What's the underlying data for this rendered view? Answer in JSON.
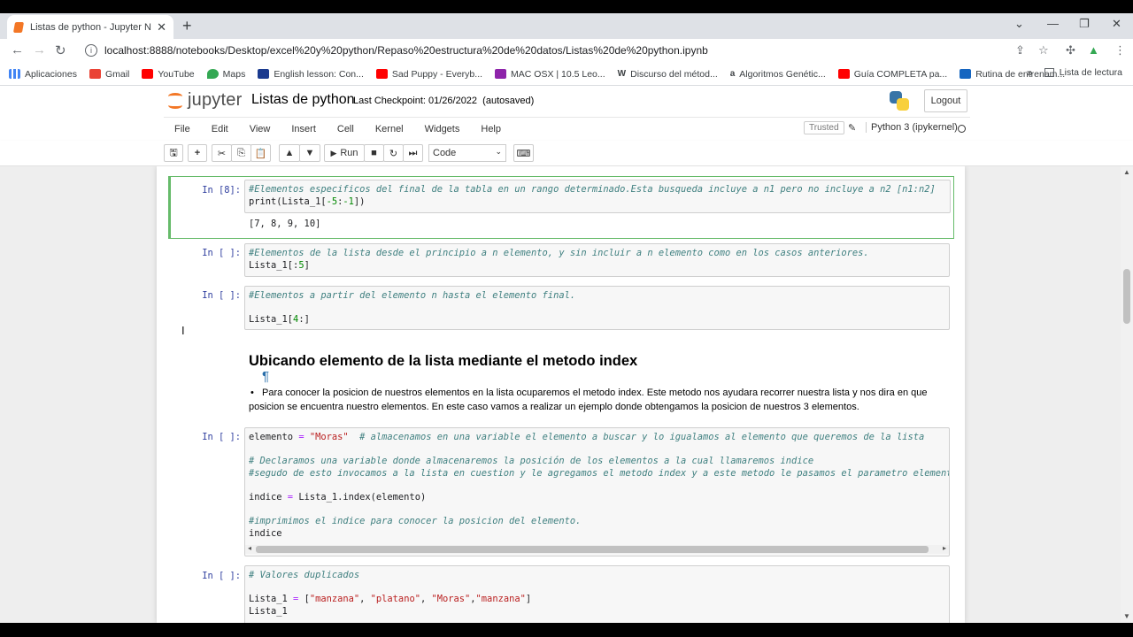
{
  "browser": {
    "tab_title": "Listas de python - Jupyter Noteb",
    "url": "localhost:8888/notebooks/Desktop/excel%20y%20python/Repaso%20estructura%20de%20datos/Listas%20de%20python.ipynb",
    "bookmarks": [
      {
        "label": "Aplicaciones",
        "color": "#4285f4"
      },
      {
        "label": "Gmail",
        "color": "#ea4335"
      },
      {
        "label": "YouTube",
        "color": "#ff0000"
      },
      {
        "label": "Maps",
        "color": "#34a853"
      },
      {
        "label": "English lesson: Con...",
        "color": "#1a3a8f"
      },
      {
        "label": "Sad Puppy - Everyb...",
        "color": "#ff0000"
      },
      {
        "label": "MAC OSX | 10.5 Leo...",
        "color": "#8e24aa"
      },
      {
        "label": "Discurso del métod...",
        "color": "#000000"
      },
      {
        "label": "Algoritmos Genétic...",
        "color": "#ff9900"
      },
      {
        "label": "Guía COMPLETA pa...",
        "color": "#ff0000"
      },
      {
        "label": "Rutina de entrenam...",
        "color": "#1565c0"
      }
    ],
    "more_bookmarks": "»",
    "reading_list": "Lista de lectura"
  },
  "jupyter": {
    "logo_text": "jupyter",
    "notebook_name": "Listas de python",
    "checkpoint": "Last Checkpoint: 01/26/2022",
    "autosaved": "(autosaved)",
    "logout": "Logout",
    "menus": [
      "File",
      "Edit",
      "View",
      "Insert",
      "Cell",
      "Kernel",
      "Widgets",
      "Help"
    ],
    "trusted": "Trusted",
    "kernel_name": "Python 3 (ipykernel)",
    "run_label": "Run",
    "cell_type": "Code"
  },
  "cells": {
    "c1": {
      "prompt": "In [8]:",
      "line1": "#Elementos especificos del final de la tabla en un rango determinado.Esta busqueda incluye a n1 pero no incluye a n2 [n1:n2]",
      "line2_a": "print(Lista_1[",
      "line2_b": "-5",
      "line2_c": ":",
      "line2_d": "-1",
      "line2_e": "])",
      "output": "[7, 8, 9, 10]"
    },
    "c2": {
      "prompt": "In [ ]:",
      "line1": "#Elementos de la lista desde el principio a n elemento, y sin incluir a n elemento como en los casos anteriores.",
      "line2_a": "Lista_1[:",
      "line2_b": "5",
      "line2_c": "]"
    },
    "c3": {
      "prompt": "In [ ]:",
      "line1": "#Elementos a partir del elemento n hasta el elemento final.",
      "line2_a": "Lista_1[",
      "line2_b": "4",
      "line2_c": ":]"
    },
    "md": {
      "heading": "Ubicando elemento de la lista mediante el metodo index",
      "pilcrow": "¶",
      "bullet": "Para conocer la posicion de nuestros elementos en la lista ocuparemos el metodo index. Este metodo nos ayudara recorrer nuestra lista y nos dira en que posicion se encuentra nuestro elementos. En este caso vamos a realizar un ejemplo donde obtengamos la posicion de nuestros 3 elementos."
    },
    "c4": {
      "prompt": "In [ ]:",
      "l1_a": "elemento ",
      "l1_b": "=",
      "l1_c": " \"Moras\"",
      "l1_d": "  # almacenamos en una variable el elemento a buscar y lo igualamos al elemento que queremos de la lista",
      "l2": "# Declaramos una variable donde almacenaremos la posición de los elementos a la cual llamaremos indice",
      "l3": "#segudo de esto invocamos a la lista en cuestion y le agregamos el metodo index y a este metodo le pasamos el parametro elemento.",
      "l4_a": "indice ",
      "l4_b": "=",
      "l4_c": " Lista_1.index(elemento)",
      "l5": "#imprimimos el indice para conocer la posicion del elemento.",
      "l6": "indice"
    },
    "c5": {
      "prompt": "In [ ]:",
      "l1": "# Valores duplicados",
      "l2_a": "Lista_1 ",
      "l2_b": "=",
      "l2_c": " [",
      "l2_d": "\"manzana\"",
      "l2_e": ", ",
      "l2_f": "\"platano\"",
      "l2_g": ", ",
      "l2_h": "\"Moras\"",
      "l2_i": ",",
      "l2_j": "\"manzana\"",
      "l2_k": "]",
      "l3": "Lista_1"
    }
  }
}
